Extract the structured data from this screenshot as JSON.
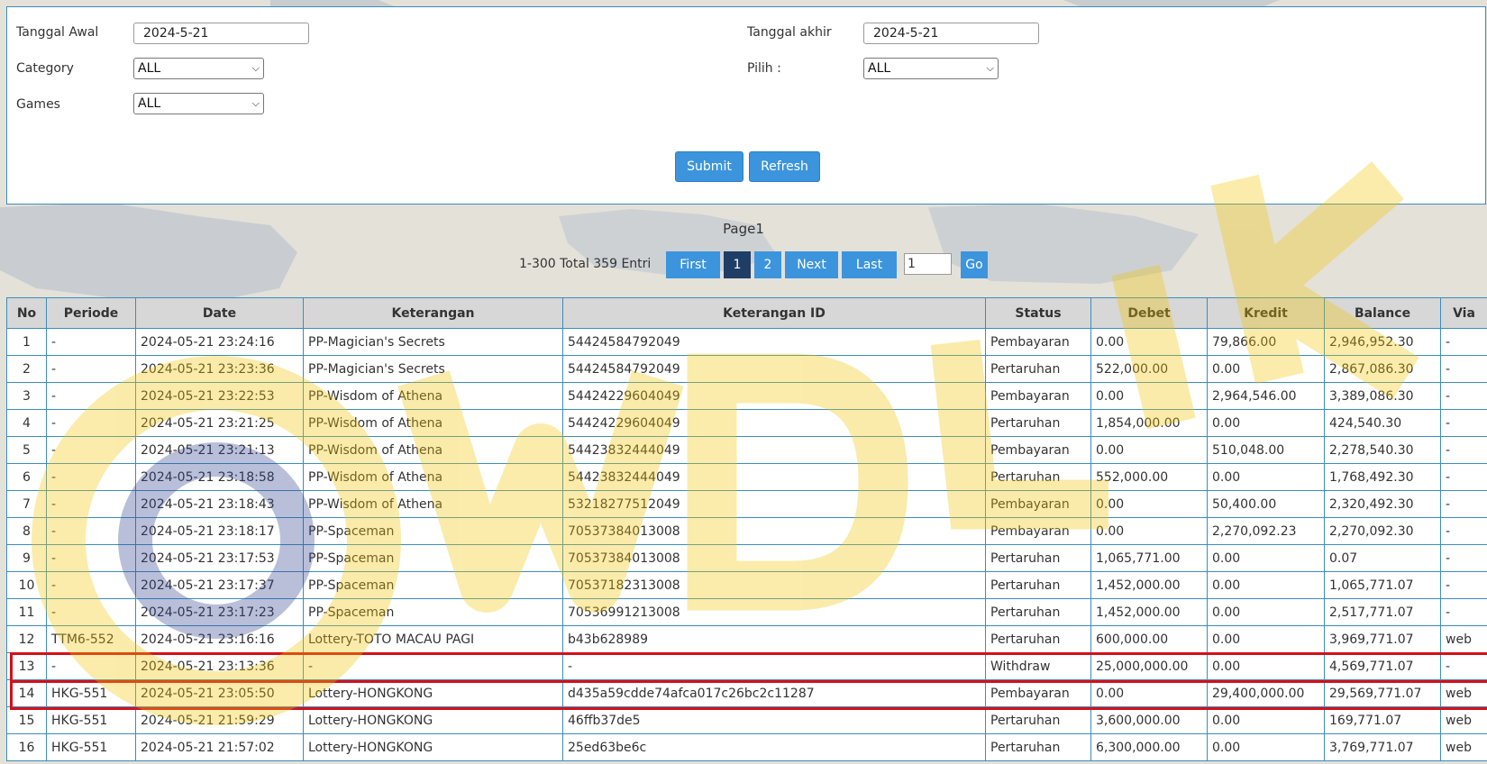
{
  "filters": {
    "start_date_label": "Tanggal Awal",
    "start_date_value": "2024-5-21",
    "end_date_label": "Tanggal akhir",
    "end_date_value": "2024-5-21",
    "category_label": "Category",
    "category_value": "ALL",
    "pilih_label": "Pilih :",
    "pilih_value": "ALL",
    "games_label": "Games",
    "games_value": "ALL",
    "submit_label": "Submit",
    "refresh_label": "Refresh"
  },
  "pagination": {
    "page_label": "Page1",
    "entries_text": "1-300 Total 359 Entri",
    "first_label": "First",
    "page1": "1",
    "page2": "2",
    "next_label": "Next",
    "last_label": "Last",
    "page_input_value": "1",
    "go_label": "Go"
  },
  "table": {
    "columns": [
      "No",
      "Periode",
      "Date",
      "Keterangan",
      "Keterangan ID",
      "Status",
      "Debet",
      "Kredit",
      "Balance",
      "Via"
    ],
    "rows": [
      [
        "1",
        "-",
        "2024-05-21 23:24:16",
        "PP-Magician's Secrets",
        "54424584792049",
        "Pembayaran",
        "0.00",
        "79,866.00",
        "2,946,952.30",
        "-"
      ],
      [
        "2",
        "-",
        "2024-05-21 23:23:36",
        "PP-Magician's Secrets",
        "54424584792049",
        "Pertaruhan",
        "522,000.00",
        "0.00",
        "2,867,086.30",
        "-"
      ],
      [
        "3",
        "-",
        "2024-05-21 23:22:53",
        "PP-Wisdom of Athena",
        "54424229604049",
        "Pembayaran",
        "0.00",
        "2,964,546.00",
        "3,389,086.30",
        "-"
      ],
      [
        "4",
        "-",
        "2024-05-21 23:21:25",
        "PP-Wisdom of Athena",
        "54424229604049",
        "Pertaruhan",
        "1,854,000.00",
        "0.00",
        "424,540.30",
        "-"
      ],
      [
        "5",
        "-",
        "2024-05-21 23:21:13",
        "PP-Wisdom of Athena",
        "54423832444049",
        "Pembayaran",
        "0.00",
        "510,048.00",
        "2,278,540.30",
        "-"
      ],
      [
        "6",
        "-",
        "2024-05-21 23:18:58",
        "PP-Wisdom of Athena",
        "54423832444049",
        "Pertaruhan",
        "552,000.00",
        "0.00",
        "1,768,492.30",
        "-"
      ],
      [
        "7",
        "-",
        "2024-05-21 23:18:43",
        "PP-Wisdom of Athena",
        "53218277512049",
        "Pembayaran",
        "0.00",
        "50,400.00",
        "2,320,492.30",
        "-"
      ],
      [
        "8",
        "-",
        "2024-05-21 23:18:17",
        "PP-Spaceman",
        "70537384013008",
        "Pembayaran",
        "0.00",
        "2,270,092.23",
        "2,270,092.30",
        "-"
      ],
      [
        "9",
        "-",
        "2024-05-21 23:17:53",
        "PP-Spaceman",
        "70537384013008",
        "Pertaruhan",
        "1,065,771.00",
        "0.00",
        "0.07",
        "-"
      ],
      [
        "10",
        "-",
        "2024-05-21 23:17:37",
        "PP-Spaceman",
        "70537182313008",
        "Pertaruhan",
        "1,452,000.00",
        "0.00",
        "1,065,771.07",
        "-"
      ],
      [
        "11",
        "-",
        "2024-05-21 23:17:23",
        "PP-Spaceman",
        "70536991213008",
        "Pertaruhan",
        "1,452,000.00",
        "0.00",
        "2,517,771.07",
        "-"
      ],
      [
        "12",
        "TTM6-552",
        "2024-05-21 23:16:16",
        "Lottery-TOTO MACAU PAGI",
        "b43b628989",
        "Pertaruhan",
        "600,000.00",
        "0.00",
        "3,969,771.07",
        "web"
      ],
      [
        "13",
        "-",
        "2024-05-21 23:13:36",
        "-",
        "-",
        "Withdraw",
        "25,000,000.00",
        "0.00",
        "4,569,771.07",
        "-"
      ],
      [
        "14",
        "HKG-551",
        "2024-05-21 23:05:50",
        "Lottery-HONGKONG",
        "d435a59cdde74afca017c26bc2c11287",
        "Pembayaran",
        "0.00",
        "29,400,000.00",
        "29,569,771.07",
        "web"
      ],
      [
        "15",
        "HKG-551",
        "2024-05-21 21:59:29",
        "Lottery-HONGKONG",
        "46ffb37de5",
        "Pertaruhan",
        "3,600,000.00",
        "0.00",
        "169,771.07",
        "web"
      ],
      [
        "16",
        "HKG-551",
        "2024-05-21 21:57:02",
        "Lottery-HONGKONG",
        "25ed63be6c",
        "Pertaruhan",
        "6,300,000.00",
        "0.00",
        "3,769,771.07",
        "web"
      ]
    ],
    "link_id_rows": [
      12,
      13,
      14,
      15
    ],
    "red_row": 12
  },
  "colors": {
    "accent": "#3c95dc",
    "active_page": "#1f3e66",
    "border": "#3c8dbc",
    "highlight": "#d4101b",
    "link": "#3a87c8"
  }
}
